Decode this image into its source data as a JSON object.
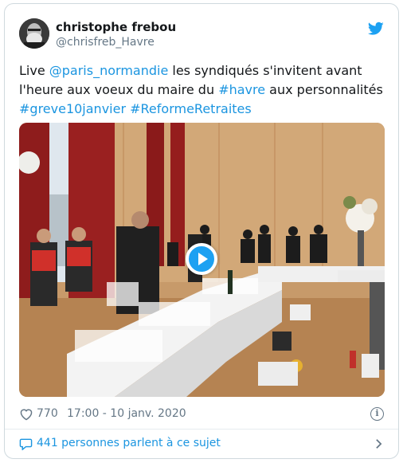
{
  "user": {
    "name": "christophe frebou",
    "handle": "@chrisfreb_Havre"
  },
  "tweet": {
    "segments": [
      {
        "text": "Live ",
        "type": "text"
      },
      {
        "text": "@paris_normandie",
        "type": "link"
      },
      {
        "text": " les syndiqués s'invitent avant l'heure aux voeux du maire du ",
        "type": "text"
      },
      {
        "text": "#havre",
        "type": "link"
      },
      {
        "text": " aux personnalités ",
        "type": "text"
      },
      {
        "text": "#greve10janvier",
        "type": "link"
      },
      {
        "text": " ",
        "type": "text"
      },
      {
        "text": "#ReformeRetraites",
        "type": "link"
      }
    ]
  },
  "meta": {
    "likes": "770",
    "timestamp": "17:00 - 10 janv. 2020"
  },
  "footer": {
    "conversation": "441 personnes parlent à ce sujet"
  },
  "icons": {
    "brand": "twitter-bird-icon",
    "like": "heart-icon",
    "info": "info-icon",
    "conversation": "speech-bubble-icon",
    "more": "chevron-right-icon",
    "media": "play-icon"
  },
  "colors": {
    "link": "#1b95e0",
    "brand": "#1da1f2",
    "muted": "#657786"
  }
}
